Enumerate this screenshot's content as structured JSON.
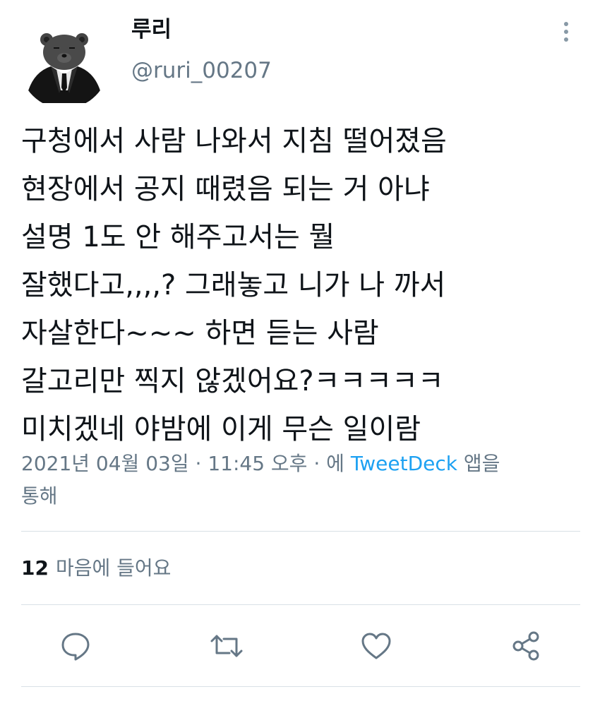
{
  "tweet": {
    "display_name": "루리",
    "handle": "@ruri_00207",
    "text_lines": [
      "구청에서 사람 나와서 지침 떨어졌음",
      "현장에서 공지 때렸음 되는 거 아냐",
      "설명 1도 안 해주고서는 뭘",
      "잘했다고,,,,? 그래놓고 니가 나 까서",
      "자살한다~~~ 하면 듣는 사람",
      "갈고리만 찍지 않겠어요?ㅋㅋㅋㅋㅋ",
      "미치겠네 야밤에 이게 무슨 일이람"
    ],
    "meta": {
      "date": "2021년 04월 03일",
      "separator": " · ",
      "time": "11:45 오후",
      "via_prefix": "에 ",
      "source": "TweetDeck",
      "via_suffix_1": " 앱을",
      "via_suffix_2": "통해"
    },
    "likes": {
      "count": "12",
      "label": "마음에 들어요"
    }
  },
  "icons": {
    "more": "vertical-ellipsis-icon",
    "reply": "speech-bubble-icon",
    "retweet": "retweet-arrows-icon",
    "like": "heart-icon",
    "share": "share-nodes-icon"
  },
  "colors": {
    "text": "#0f1419",
    "secondary": "#657786",
    "link": "#1da1f2",
    "divider": "#d9e0e6"
  }
}
